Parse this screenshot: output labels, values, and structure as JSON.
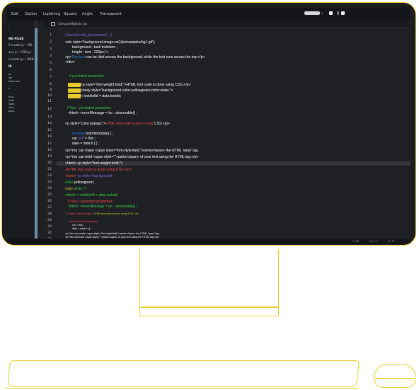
{
  "menubar": {
    "items": [
      "Edit",
      "Option",
      "Lightning",
      "Square",
      "Angle",
      "Transparent"
    ]
  },
  "tab": {
    "label": "CompareObjects.css"
  },
  "sidebar": {
    "lines": [
      ":",
      "NG FILES",
      "5 model.js • OB..",
      "ans.js • ICBA.js..",
      "k.model.js • BOB..",
      "IS",
      "",
      "id:",
      "ion",
      "folder.sss",
      "s",
      "",
      "func.",
      "tadd..",
      "loper..",
      "slice..",
      "pose.."
    ]
  },
  "line_numbers": [
    "1",
    "2",
    "3",
    "4",
    "5",
    "6",
    "7",
    "8",
    "9",
    "10",
    "11",
    "12",
    "13",
    "14",
    "15",
    "16",
    "17",
    "18",
    "19",
    "20",
    "21",
    "22",
    "23",
    "24",
    "25",
    "26",
    "27",
    "28",
    "29",
    "30",
    "31",
    "32"
  ],
  "code": {
    "l1": "{ function  init_declaration() : {",
    "l2": "<div style=\"background-image:url('/pix/samples/bg1.gif');",
    "l3": "background : task todoitem ;",
    "l4": "height : text - 200px;\">",
    "l5a": "<p>",
    "l5b": "This text",
    "l5c": " can be tiled across the background, while the text runs across the top.</p>",
    "l6": "</div>",
    "l7": "//  persisted properties",
    "l8a": "<p style=\"font-weight:bold;\">HTML font code is done using CSS.</p>",
    "l9a": "<body style=\"background-color:yellowgreen;color:white;\">",
    "l10a": "< todolistId = data.todoId;",
    "hl_word": "xxxxxxx",
    "l12": "// Non - persisted properties",
    "l13": "<html> <errorMessage = ko . observable() ;",
    "l14a": "<p style=\"color:orange;\">",
    "l14b": "HTML font code is done using",
    "l14c": " CSS.</p>",
    "l15a": "function",
    "l15b": " todoItem(data) { ;",
    "l16a": "var ",
    "l16b": "self",
    "l16c": " = this ;",
    "l17": "data = data  ll  { } ;",
    "l18": "<p>You can make <span style=\"font-style:italic\">some</span> the HTML 'span' tag.",
    "l19": "<p>You can bold <span style=\"\">parts</span> of your text using the HTML tag.</p>",
    "l20": "<html> <p style=\"font-weight:bold;\">",
    "l21": ">HTML font code is done using CSS </p>",
    "l22a": "<html>",
    "l22b": " <p style=\"background-",
    "l23a": "color:",
    "l23b": "yellowgreen;",
    "l24a": "color:",
    "l24b": "white;\">",
    "l25": "<html> < todolistId = data.todoId;",
    "l26": "// Non - persisted properties",
    "l27": "<html> <errorMessage = ko . observable() ;",
    "l28a": "<p style=\"color:orange;\">",
    "l28b": "HTML font code is done using CSS.</p>",
    "l29": "function todoItem(data) {",
    "l30": "var      = this ;",
    "l31": "data = data  ll  { } ;",
    "l32": "<p>You can make <span style=\"font-style:italic\">some</span> the HTML 'span' tag.",
    "l33": "<p>You can bold <span style=\"\">parts</span> of your text using the HTML tag.</p>"
  },
  "status": {
    "a": "Ln 88",
    "b": "Col 17",
    "c": "Ch 74"
  },
  "colors": {
    "accent_yellow": "#e8cb2a",
    "comment_green": "#36d047",
    "keyword_purple": "#8a64e0",
    "string_red": "#ff4a4a",
    "type_blue": "#2f7df0"
  }
}
